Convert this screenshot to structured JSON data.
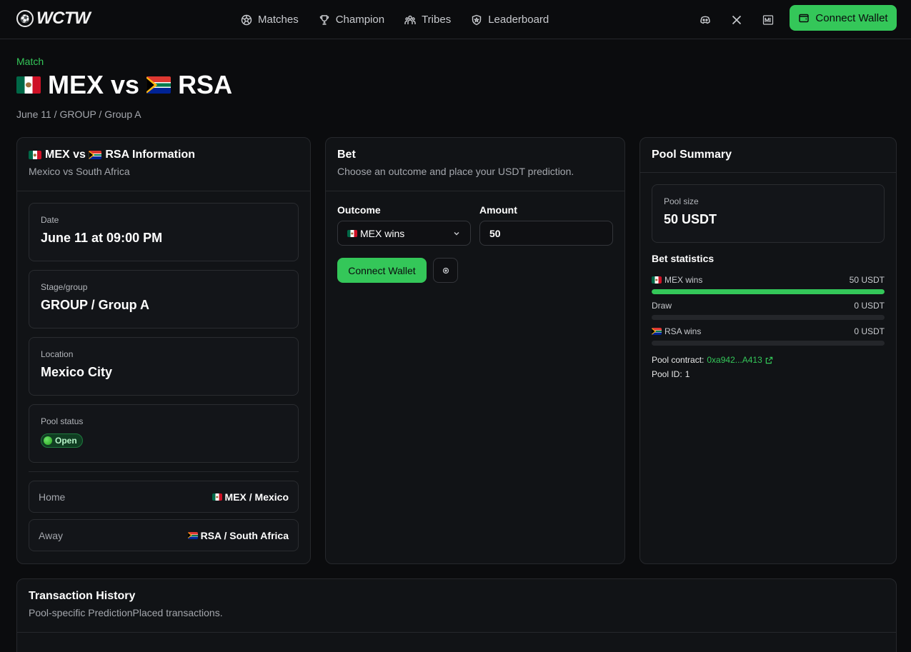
{
  "brand": {
    "name": "WCTW"
  },
  "nav": [
    {
      "label": "Matches",
      "icon": "soccer-ball-icon"
    },
    {
      "label": "Champion",
      "icon": "trophy-icon"
    },
    {
      "label": "Tribes",
      "icon": "users-icon"
    },
    {
      "label": "Leaderboard",
      "icon": "shield-icon"
    }
  ],
  "header": {
    "connect_label": "Connect Wallet"
  },
  "page": {
    "eyebrow": "Match",
    "title_home": "MEX",
    "title_vs": "vs",
    "title_away": "RSA",
    "subtitle": "June 11 / GROUP / Group A"
  },
  "info_card": {
    "title": "MEX vs",
    "title_away": "RSA Information",
    "description": "Mexico vs South Africa",
    "date_label": "Date",
    "date_value": "June 11 at 09:00 PM",
    "stage_label": "Stage/group",
    "stage_value": "GROUP / Group A",
    "location_label": "Location",
    "location_value": "Mexico City",
    "status_label": "Pool status",
    "status_value": "Open",
    "home_label": "Home",
    "home_value": "MEX / Mexico",
    "away_label": "Away",
    "away_value": "RSA / South Africa"
  },
  "bet_card": {
    "title": "Bet",
    "description": "Choose an outcome and place your USDT prediction.",
    "outcome_label": "Outcome",
    "outcome_value": "MEX wins",
    "amount_label": "Amount",
    "amount_value": "50",
    "connect_label": "Connect Wallet"
  },
  "pool_card": {
    "title": "Pool Summary",
    "size_label": "Pool size",
    "size_value": "50 USDT",
    "stats_title": "Bet statistics",
    "stats": [
      {
        "name": "MEX wins",
        "amount": "50 USDT",
        "fraction": 1.0
      },
      {
        "name": "Draw",
        "amount": "0 USDT",
        "fraction": 0.0
      },
      {
        "name": "RSA wins",
        "amount": "0 USDT",
        "fraction": 0.0
      }
    ],
    "contract_label": "Pool contract:",
    "contract_value": "0xa942...A413",
    "pool_id_label": "Pool ID:",
    "pool_id_value": "1"
  },
  "history_card": {
    "title": "Transaction History",
    "description": "Pool-specific PredictionPlaced transactions."
  },
  "colors": {
    "accent": "#34c759",
    "background": "#0b0c0e",
    "card": "#111316",
    "border": "#26282c"
  }
}
